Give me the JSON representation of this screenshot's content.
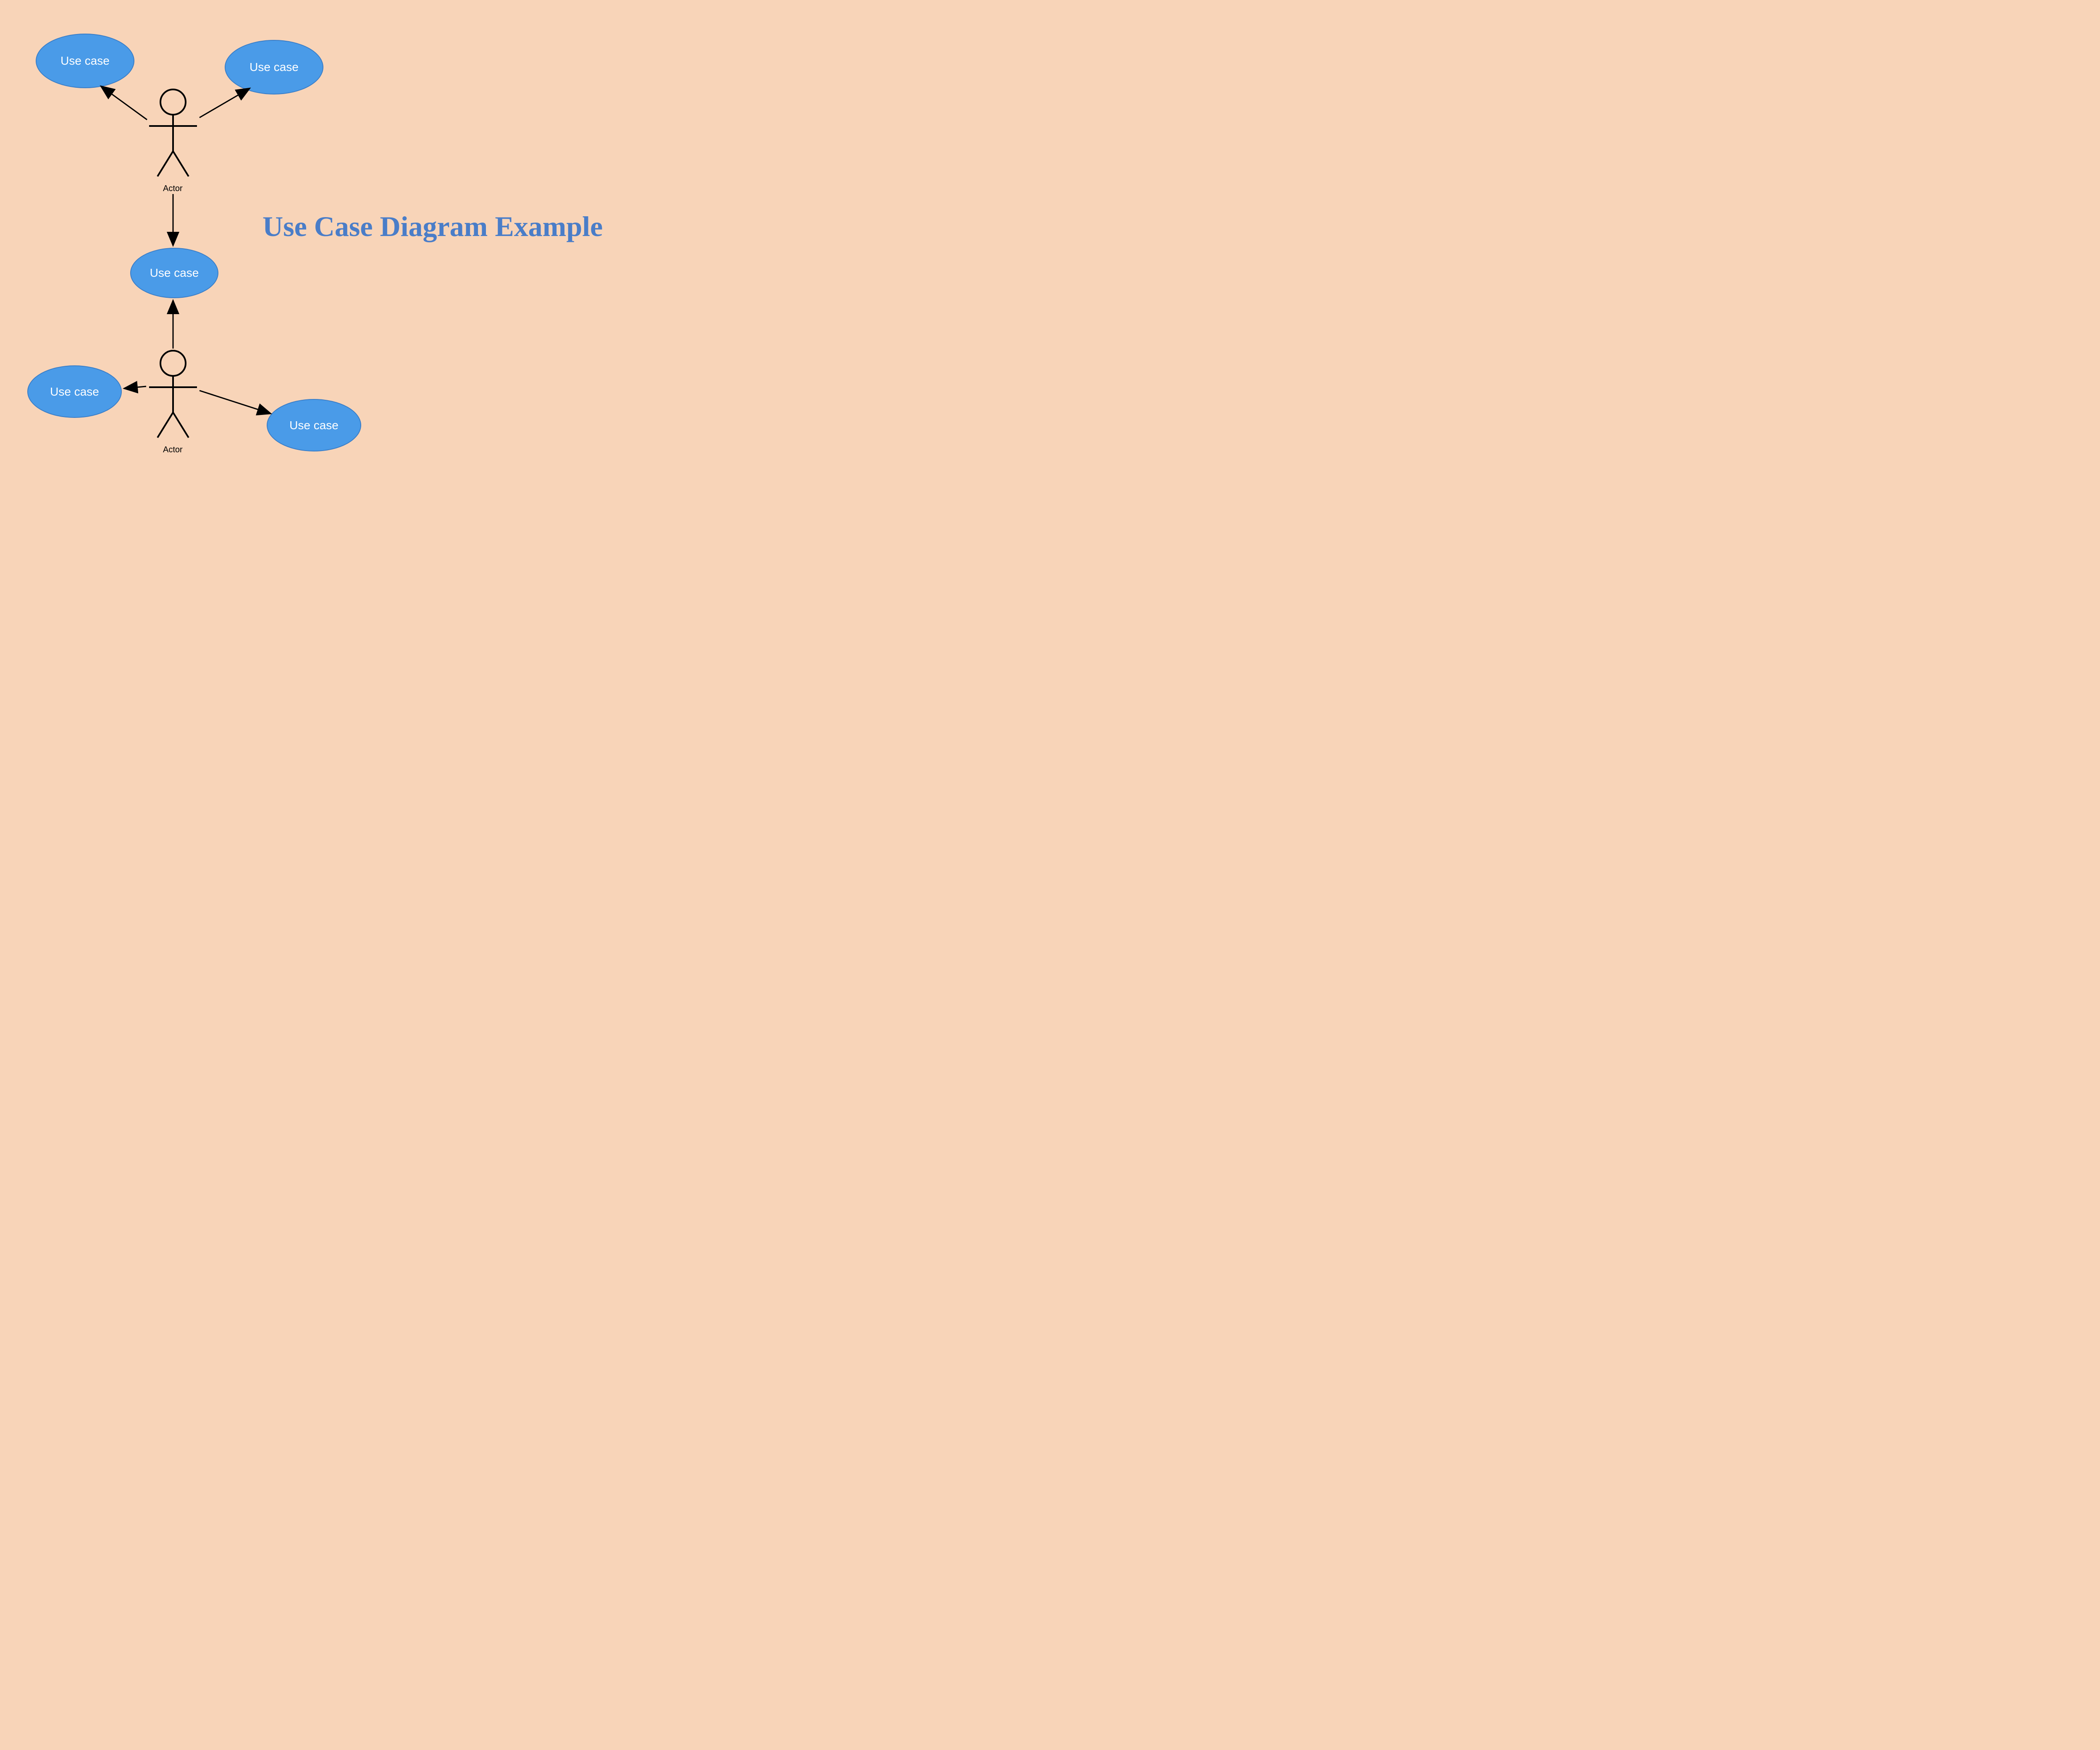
{
  "title": "Use Case Diagram Example",
  "actors": {
    "top": {
      "label": "Actor"
    },
    "bottom": {
      "label": "Actor"
    }
  },
  "useCases": {
    "topLeft": {
      "label": "Use case"
    },
    "topRight": {
      "label": "Use case"
    },
    "middle": {
      "label": "Use case"
    },
    "bottomLeft": {
      "label": "Use case"
    },
    "bottomRight": {
      "label": "Use case"
    }
  },
  "colors": {
    "background": "#f8d4b8",
    "useCaseFill": "#4a9be8",
    "useCaseStroke": "#3a7ec8",
    "titleColor": "#4a7dc8"
  }
}
